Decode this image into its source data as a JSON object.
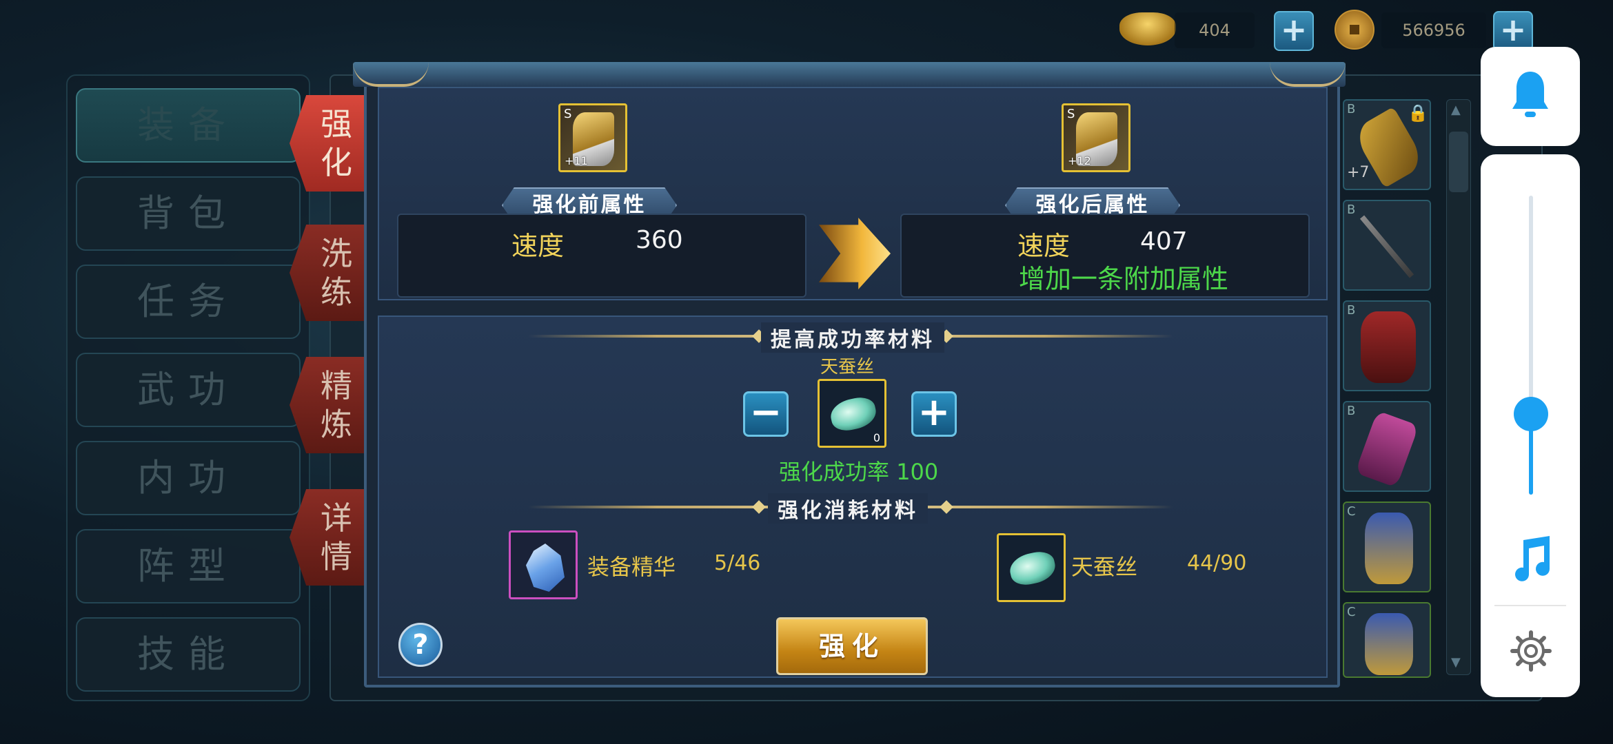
{
  "currency": {
    "ingot_value": "404",
    "coin_value": "566956"
  },
  "menu": {
    "items": [
      {
        "label": "装备",
        "active": true
      },
      {
        "label": "背包",
        "active": false
      },
      {
        "label": "任务",
        "active": false
      },
      {
        "label": "武功",
        "active": false
      },
      {
        "label": "内功",
        "active": false
      },
      {
        "label": "阵型",
        "active": false
      },
      {
        "label": "技能",
        "active": false
      }
    ]
  },
  "side_tabs": [
    {
      "line1": "强",
      "line2": "化",
      "active": true
    },
    {
      "line1": "洗",
      "line2": "练",
      "active": false
    },
    {
      "line1": "精",
      "line2": "炼",
      "active": false
    },
    {
      "line1": "详",
      "line2": "情",
      "active": false
    }
  ],
  "inventory": {
    "slots": [
      {
        "grade": "B",
        "level": "+7",
        "locked": true
      },
      {
        "grade": "B",
        "level": ""
      },
      {
        "grade": "B",
        "level": ""
      },
      {
        "grade": "B",
        "level": ""
      },
      {
        "grade": "C",
        "level": ""
      },
      {
        "grade": "C",
        "level": ""
      }
    ]
  },
  "enhance": {
    "before": {
      "ribbon": "强化前属性",
      "item_grade": "S",
      "item_level": "+11",
      "stat_name": "速度",
      "stat_value": "360"
    },
    "after": {
      "ribbon": "强化后属性",
      "item_grade": "S",
      "item_level": "+12",
      "stat_name": "速度",
      "stat_value": "407",
      "bonus_text": "增加一条附加属性"
    },
    "success_section": {
      "title": "提高成功率材料",
      "material_name": "天蚕丝",
      "material_count": "0",
      "minus_label": "−",
      "plus_label": "+",
      "rate_label": "强化成功率",
      "rate_value": "100"
    },
    "cost_section": {
      "title": "强化消耗材料",
      "materials": [
        {
          "name": "装备精华",
          "amount": "5/46",
          "border": "#cc4fc0"
        },
        {
          "name": "天蚕丝",
          "amount": "44/90",
          "border": "#e5c134"
        }
      ]
    },
    "help_label": "?",
    "button_label": "强化"
  },
  "colors": {
    "accent_gold": "#e6c54a",
    "success_green": "#4dd84a",
    "tab_red": "#c0392b",
    "slider_blue": "#1ba1f2"
  },
  "system_controls": {
    "icons": [
      "bell-icon",
      "music-note-icon",
      "gear-icon"
    ],
    "volume_level": 0.27
  }
}
